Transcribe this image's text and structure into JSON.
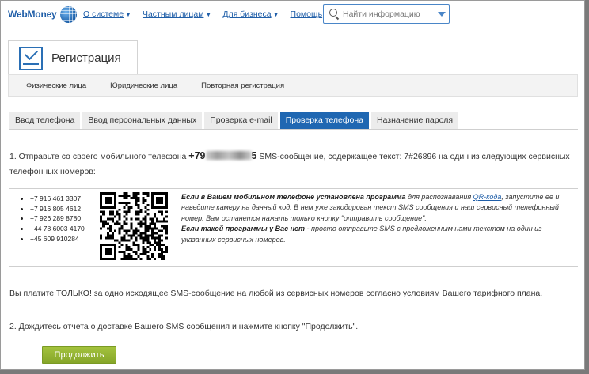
{
  "logo": {
    "text": "WebMoney"
  },
  "nav": {
    "items": [
      {
        "label": "О системе"
      },
      {
        "label": "Частным лицам"
      },
      {
        "label": "Для бизнеса"
      },
      {
        "label": "Помощь"
      }
    ],
    "search": {
      "placeholder": "Найти информацию"
    }
  },
  "registration": {
    "title": "Регистрация",
    "subnav": [
      "Физические лица",
      "Юридические лица",
      "Повторная регистрация"
    ]
  },
  "steps": [
    {
      "label": "Ввод телефона",
      "active": false
    },
    {
      "label": "Ввод персональных данных",
      "active": false
    },
    {
      "label": "Проверка e-mail",
      "active": false
    },
    {
      "label": "Проверка телефона",
      "active": true
    },
    {
      "label": "Назначение пароля",
      "active": false
    }
  ],
  "step1": {
    "prefix": "1. Отправьте со своего мобильного телефона ",
    "phone": "+79",
    "phone_tail": "5",
    "suffix": " SMS-сообщение, содержащее текст: 7#26896 на один из следующих сервисных телефонных номеров:"
  },
  "service_numbers": [
    "+7 916 461 3307",
    "+7 916 805 4612",
    "+7 926 289 8780",
    "+44 78 6003 4170",
    "+45 609 910284"
  ],
  "qr_info": {
    "line1_bold": "Если в Вашем мобильном телефоне установлена программа",
    "line1_rest": " для распознавания ",
    "qr_link": "QR-кода",
    "line1_after": ", запустите ее и наведите камеру на данный код. В нем уже закодирован текст SMS сообщения и наш сервисный телефонный номер. Вам останется нажать только кнопку \"отправить сообщение\".",
    "line2_bold": "Если такой программы у Вас нет",
    "line2_rest": " - просто отправьте SMS с предложенным нами текстом на один из указанных сервисных номеров."
  },
  "payment_note": "Вы платите ТОЛЬКО! за одно исходящее SMS-сообщение на любой из сервисных номеров согласно условиям Вашего тарифного плана.",
  "step2": "2. Дождитесь отчета о доставке Вашего SMS сообщения и нажмите кнопку \"Продолжить\".",
  "continue_label": "Продолжить",
  "colors": {
    "accent": "#1f67b2",
    "button": "#94b335",
    "link": "#1f5ea8"
  }
}
